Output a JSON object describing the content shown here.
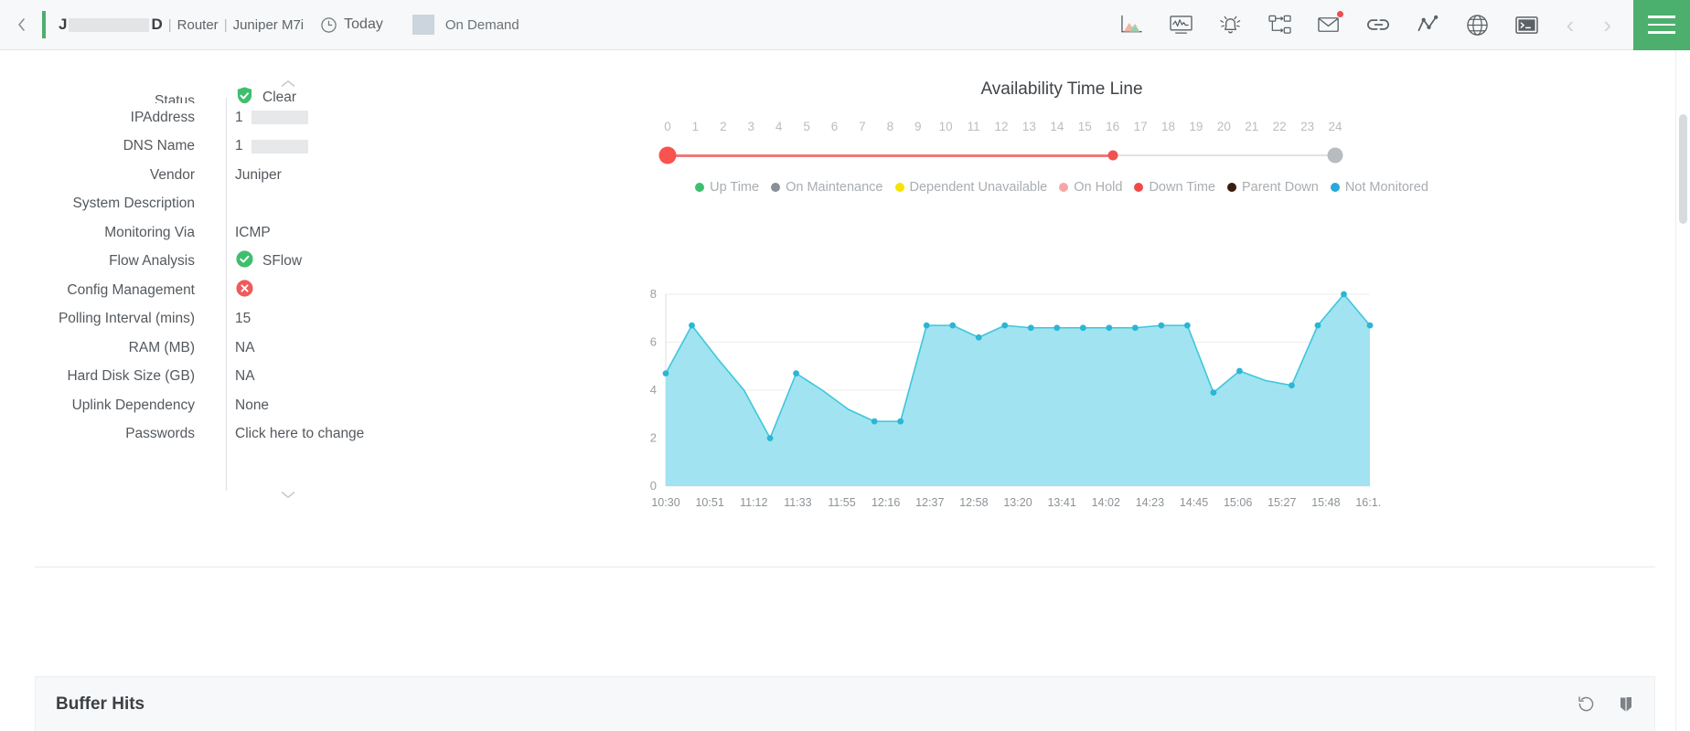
{
  "header": {
    "collapse_icon": "chevron-left-icon",
    "device_name_prefix": "J",
    "device_name_suffix": "D",
    "breadcrumbs": [
      "Router",
      "Juniper M7i"
    ],
    "period_label": "Today",
    "period_icon": "clock-icon",
    "on_demand_label": "On Demand",
    "icons": [
      {
        "name": "area-chart-icon",
        "title": "Performance"
      },
      {
        "name": "monitor-graph-icon",
        "title": "Monitor"
      },
      {
        "name": "alarm-bell-icon",
        "title": "Alerts"
      },
      {
        "name": "network-topology-icon",
        "title": "Topology"
      },
      {
        "name": "mail-icon",
        "title": "Notifications",
        "badge": true
      },
      {
        "name": "link-chain-icon",
        "title": "Links"
      },
      {
        "name": "line-chart-icon",
        "title": "Trends"
      },
      {
        "name": "globe-icon",
        "title": "Web"
      },
      {
        "name": "terminal-icon",
        "title": "Console"
      }
    ],
    "prev_label": "‹",
    "next_label": "›",
    "menu_icon": "hamburger-menu-icon"
  },
  "details": {
    "scroll_up_icon": "chevron-up-icon",
    "scroll_down_icon": "chevron-down-icon",
    "rows": [
      {
        "label": "Status",
        "value": "Clear",
        "icon": "shield-check-icon"
      },
      {
        "label": "IPAddress",
        "value": "1",
        "redacted": true
      },
      {
        "label": "DNS Name",
        "value": "1",
        "redacted": true
      },
      {
        "label": "Vendor",
        "value": "Juniper"
      },
      {
        "label": "System Description",
        "value": ""
      },
      {
        "label": "Monitoring Via",
        "value": "ICMP"
      },
      {
        "label": "Flow Analysis",
        "value": "SFlow",
        "icon": "circle-check-icon"
      },
      {
        "label": "Config Management",
        "value": "",
        "icon": "circle-x-icon"
      },
      {
        "label": "Polling Interval (mins)",
        "value": "15"
      },
      {
        "label": "RAM (MB)",
        "value": "NA"
      },
      {
        "label": "Hard Disk Size (GB)",
        "value": "NA"
      },
      {
        "label": "Uplink Dependency",
        "value": "None"
      },
      {
        "label": "Passwords",
        "value": "Click here to change"
      }
    ]
  },
  "availability": {
    "title": "Availability Time Line",
    "scale_ticks": [
      "0",
      "1",
      "2",
      "3",
      "4",
      "5",
      "6",
      "7",
      "8",
      "9",
      "10",
      "11",
      "12",
      "13",
      "14",
      "15",
      "16",
      "17",
      "18",
      "19",
      "20",
      "21",
      "22",
      "23",
      "24"
    ],
    "scale_min": 0,
    "scale_max": 24,
    "segment_end_hour": 16,
    "segment_color": "#f05b5b",
    "remaining_color": "#dfe2e4",
    "legend": [
      {
        "label": "Up Time",
        "color": "#3fbf6e"
      },
      {
        "label": "On Maintenance",
        "color": "#8a9095"
      },
      {
        "label": "Dependent Unavailable",
        "color": "#f5e400"
      },
      {
        "label": "On Hold",
        "color": "#f7a6a6"
      },
      {
        "label": "Down Time",
        "color": "#ef4a4a"
      },
      {
        "label": "Parent Down",
        "color": "#3b1d10"
      },
      {
        "label": "Not Monitored",
        "color": "#29a8dd"
      }
    ]
  },
  "chart_data": {
    "type": "area",
    "title": "",
    "xlabel": "",
    "ylabel": "",
    "ylim": [
      0,
      8
    ],
    "yticks": [
      0,
      2,
      4,
      6,
      8
    ],
    "grid": true,
    "line_color": "#3ec6dd",
    "fill_color": "#9ce1ef",
    "categories": [
      "10:30",
      "10:51",
      "11:12",
      "11:33",
      "11:55",
      "12:16",
      "12:37",
      "12:58",
      "13:20",
      "13:41",
      "14:02",
      "14:23",
      "14:45",
      "15:06",
      "15:27",
      "15:48",
      "16:1.."
    ],
    "x": [
      "10:30",
      "10:41",
      "10:51",
      "11:02",
      "11:12",
      "11:23",
      "11:33",
      "11:44",
      "11:55",
      "12:05",
      "12:16",
      "12:27",
      "12:37",
      "12:48",
      "12:58",
      "13:09",
      "13:20",
      "13:30",
      "13:41",
      "13:52",
      "14:02",
      "14:13",
      "14:23",
      "14:34",
      "14:45",
      "14:55",
      "15:06",
      "15:17",
      "15:27",
      "15:38",
      "15:48",
      "15:59",
      "16:10"
    ],
    "values": [
      4.7,
      6.7,
      5.3,
      4.0,
      2.0,
      4.7,
      4.0,
      3.2,
      2.7,
      2.7,
      6.7,
      6.7,
      6.2,
      6.7,
      6.6,
      6.6,
      6.6,
      6.6,
      6.6,
      6.7,
      6.7,
      3.9,
      4.8,
      4.4,
      4.2,
      6.7,
      8.0,
      6.7
    ],
    "series": [
      {
        "name": "Buffer Hits",
        "values": [
          4.7,
          6.7,
          5.3,
          4.0,
          2.0,
          4.7,
          4.0,
          3.2,
          2.7,
          2.7,
          6.7,
          6.7,
          6.2,
          6.7,
          6.6,
          6.6,
          6.6,
          6.6,
          6.6,
          6.7,
          6.7,
          3.9,
          4.8,
          4.4,
          4.2,
          6.7,
          8.0,
          6.7
        ]
      }
    ],
    "points": [
      {
        "t": "10:30",
        "v": 4.7
      },
      {
        "t": "10:51",
        "v": 6.7
      },
      {
        "t": "11:33",
        "v": 2.0
      },
      {
        "t": "11:55",
        "v": 4.7
      },
      {
        "t": "12:37",
        "v": 2.7
      },
      {
        "t": "12:48",
        "v": 2.7
      },
      {
        "t": "12:58",
        "v": 6.7
      },
      {
        "t": "13:09",
        "v": 6.7
      },
      {
        "t": "13:20",
        "v": 6.2
      },
      {
        "t": "13:30",
        "v": 6.7
      },
      {
        "t": "13:41",
        "v": 6.6
      },
      {
        "t": "14:02",
        "v": 6.6
      },
      {
        "t": "14:23",
        "v": 6.6
      },
      {
        "t": "14:45",
        "v": 3.9
      },
      {
        "t": "15:06",
        "v": 4.8
      },
      {
        "t": "15:27",
        "v": 4.2
      },
      {
        "t": "15:48",
        "v": 6.7
      },
      {
        "t": "16:05",
        "v": 8.0
      },
      {
        "t": "16:10",
        "v": 6.7
      }
    ]
  },
  "buffer_panel": {
    "title": "Buffer Hits",
    "refresh_icon": "refresh-counterclockwise-icon",
    "expand_icon": "pin-icon"
  }
}
